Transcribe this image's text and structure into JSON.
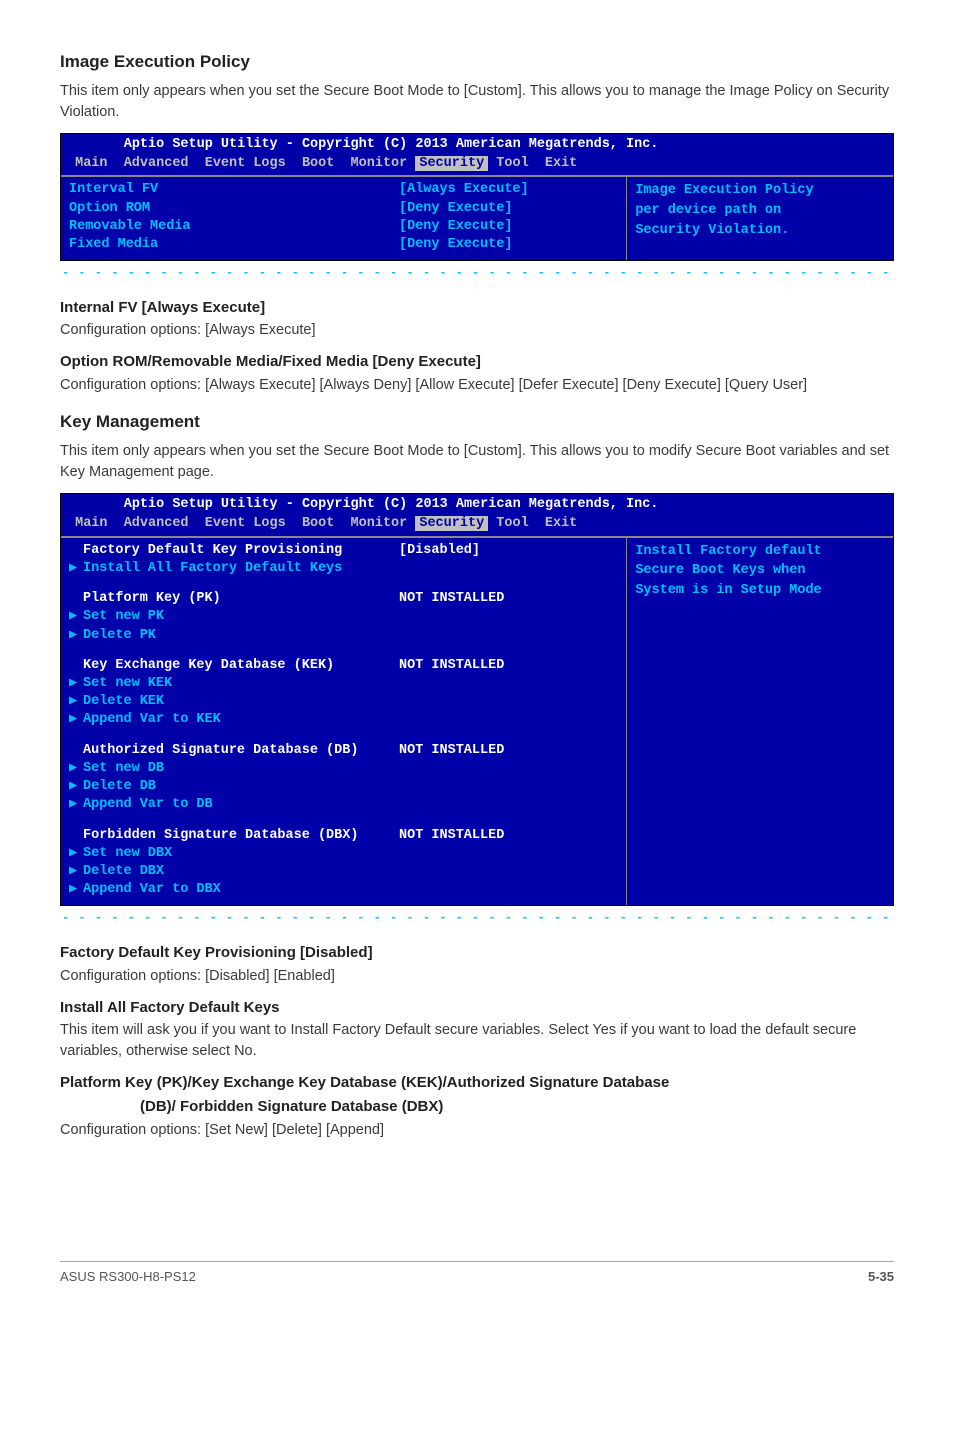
{
  "section1": {
    "title": "Image Execution Policy",
    "desc": "This item only appears when you set the Secure Boot Mode to [Custom]. This allows you to manage the Image Policy on Security Violation."
  },
  "bios1": {
    "header": "Aptio Setup Utility - Copyright (C) 2013 American Megatrends, Inc.",
    "tabs_pre": " Main  Advanced  Event Logs  Boot  Monitor ",
    "tabs_active": "Security",
    "tabs_post": " Tool  Exit",
    "rows": [
      {
        "label": "Interval FV",
        "value": "[Always Execute]"
      },
      {
        "label": "Option ROM",
        "value": "[Deny Execute]"
      },
      {
        "label": "Removable Media",
        "value": "[Deny Execute]"
      },
      {
        "label": "Fixed Media",
        "value": "[Deny Execute]"
      }
    ],
    "help": [
      "Image Execution Policy",
      "per device path on",
      "Security Violation."
    ]
  },
  "sub1": {
    "title": "Internal FV [Always Execute]",
    "text": "Configuration options: [Always Execute]"
  },
  "sub2": {
    "title": "Option ROM/Removable Media/Fixed Media [Deny Execute]",
    "text": "Configuration options: [Always Execute] [Always Deny] [Allow Execute] [Defer Execute] [Deny Execute] [Query User]"
  },
  "section2": {
    "title": "Key Management",
    "desc": "This item only appears when you set the Secure Boot Mode to [Custom]. This allows you to modify Secure Boot variables and set Key Management page."
  },
  "bios2": {
    "header": "Aptio Setup Utility - Copyright (C) 2013 American Megatrends, Inc.",
    "tabs_pre": " Main  Advanced  Event Logs  Boot  Monitor ",
    "tabs_active": "Security",
    "tabs_post": " Tool  Exit",
    "groups": [
      {
        "rows": [
          {
            "arrow": false,
            "label": "Factory Default Key Provisioning",
            "value": "[Disabled]",
            "lcolor": "white",
            "vcolor": "white"
          },
          {
            "arrow": true,
            "label": "Install All Factory Default Keys",
            "value": "",
            "lcolor": "cyan"
          }
        ]
      },
      {
        "rows": [
          {
            "arrow": false,
            "label": "Platform Key (PK)",
            "value": "NOT INSTALLED",
            "lcolor": "white",
            "vcolor": "white"
          },
          {
            "arrow": true,
            "label": "Set new PK",
            "value": "",
            "lcolor": "cyan"
          },
          {
            "arrow": true,
            "label": "Delete PK",
            "value": "",
            "lcolor": "cyan"
          }
        ]
      },
      {
        "rows": [
          {
            "arrow": false,
            "label": "Key Exchange Key Database (KEK)",
            "value": "NOT INSTALLED",
            "lcolor": "white",
            "vcolor": "white"
          },
          {
            "arrow": true,
            "label": "Set new KEK",
            "value": "",
            "lcolor": "cyan"
          },
          {
            "arrow": true,
            "label": "Delete KEK",
            "value": "",
            "lcolor": "cyan"
          },
          {
            "arrow": true,
            "label": "Append Var to KEK",
            "value": "",
            "lcolor": "cyan"
          }
        ]
      },
      {
        "rows": [
          {
            "arrow": false,
            "label": "Authorized Signature Database (DB)",
            "value": "NOT INSTALLED",
            "lcolor": "white",
            "vcolor": "white"
          },
          {
            "arrow": true,
            "label": "Set new DB",
            "value": "",
            "lcolor": "cyan"
          },
          {
            "arrow": true,
            "label": "Delete DB",
            "value": "",
            "lcolor": "cyan"
          },
          {
            "arrow": true,
            "label": "Append Var to DB",
            "value": "",
            "lcolor": "cyan"
          }
        ]
      },
      {
        "rows": [
          {
            "arrow": false,
            "label": "Forbidden Signature Database (DBX)",
            "value": "NOT INSTALLED",
            "lcolor": "white",
            "vcolor": "white"
          },
          {
            "arrow": true,
            "label": "Set new DBX",
            "value": "",
            "lcolor": "cyan"
          },
          {
            "arrow": true,
            "label": "Delete DBX",
            "value": "",
            "lcolor": "cyan"
          },
          {
            "arrow": true,
            "label": "Append Var to DBX",
            "value": "",
            "lcolor": "cyan"
          }
        ]
      }
    ],
    "help": [
      "Install Factory default",
      "Secure Boot Keys when",
      "System is in Setup Mode"
    ]
  },
  "sub3": {
    "title": "Factory Default Key Provisioning [Disabled]",
    "text": "Configuration options: [Disabled] [Enabled]"
  },
  "sub4": {
    "title": "Install All Factory Default Keys",
    "text": "This item will ask you if you want to Install Factory Default secure variables. Select Yes if you want to load the default secure variables, otherwise select No."
  },
  "sub5": {
    "title": "Platform Key (PK)/Key Exchange Key Database (KEK)/Authorized Signature Database",
    "title2": "(DB)/ Forbidden Signature Database (DBX)",
    "text": "Configuration options: [Set New] [Delete] [Append]"
  },
  "footer": {
    "left": "ASUS RS300-H8-PS12",
    "right": "5-35"
  },
  "dashes": "- - - - - - - - - - - - - - - - - - - - - - - - - - - - - - - - - - - - - - - - - - - - - - - - - - - - - -"
}
